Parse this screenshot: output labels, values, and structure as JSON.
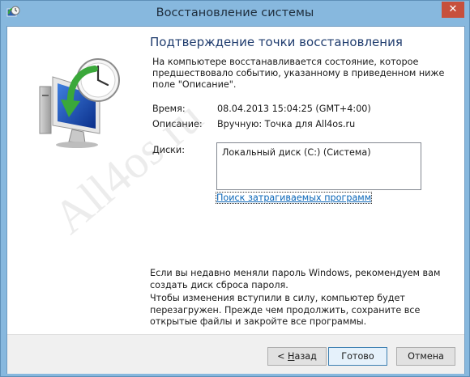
{
  "window": {
    "title": "Восстановление системы",
    "close_glyph": "✕"
  },
  "page": {
    "title": "Подтверждение точки восстановления",
    "description": "На компьютере восстанавливается состояние, которое предшествовало событию, указанному в приведенном ниже поле \"Описание\"."
  },
  "details": {
    "time_label": "Время:",
    "time_value": "08.04.2013 15:04:25 (GMT+4:00)",
    "description_label": "Описание:",
    "description_value": "Вручную: Точка для All4os.ru",
    "disks_label": "Диски:",
    "disks": [
      "Локальный диск (C:) (Система)"
    ],
    "scan_link": "Поиск затрагиваемых программ"
  },
  "notes": {
    "password": "Если вы недавно меняли пароль Windows, рекомендуем вам создать диск сброса пароля.",
    "restart": "Чтобы изменения вступили в силу, компьютер будет перезагружен. Прежде чем продолжить, сохраните все открытые файлы и закройте все программы."
  },
  "buttons": {
    "back_prefix": "< ",
    "back_accel": "Н",
    "back_rest": "азад",
    "finish": "Готово",
    "cancel": "Отмена"
  },
  "watermark": "All4os.ru",
  "colors": {
    "title_bar": "#87b8de",
    "close_button": "#c7503c",
    "link": "#0a66b8",
    "heading": "#1f3c6e"
  },
  "icons": {
    "window_icon": "system-restore-icon",
    "hero_icon": "system-restore-clock-icon"
  }
}
